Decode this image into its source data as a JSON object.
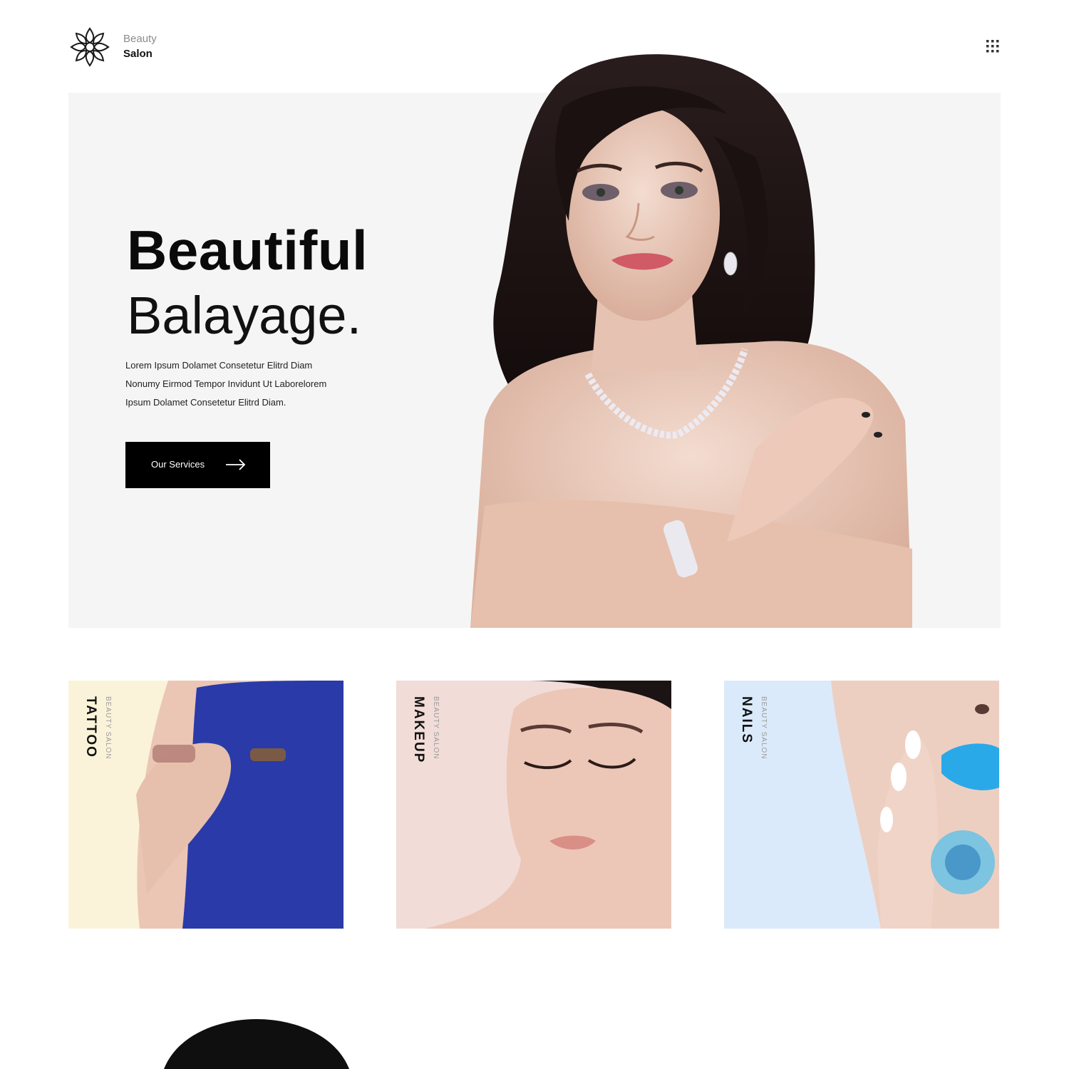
{
  "header": {
    "brand_top": "Beauty",
    "brand_bottom": "Salon",
    "logo_icon": "lotus-icon",
    "menu_icon": "grid-menu-icon"
  },
  "hero": {
    "title_bold": "Beautiful",
    "title_light": "Balayage.",
    "description": [
      "Lorem Ipsum Dolamet Consetetur Elitrd Diam",
      "Nonumy Eirmod Tempor Invidunt Ut Laborelorem",
      "Ipsum Dolamet Consetetur Elitrd Diam."
    ],
    "cta_label": "Our Services",
    "cta_icon": "arrow-right-icon",
    "background": "#f5f5f5"
  },
  "cards": [
    {
      "title": "TATTOO",
      "subtitle": "BEAUTY SALON",
      "background": "#fbf3d9",
      "accent": "#2a3aa8"
    },
    {
      "title": "MAKEUP",
      "subtitle": "BEAUTY SALON",
      "background": "#f1dcd8",
      "accent": "#e8b7a4"
    },
    {
      "title": "NAILS",
      "subtitle": "BEAUTY SALON",
      "background": "#dbeafa",
      "accent": "#2aa9e8"
    }
  ]
}
